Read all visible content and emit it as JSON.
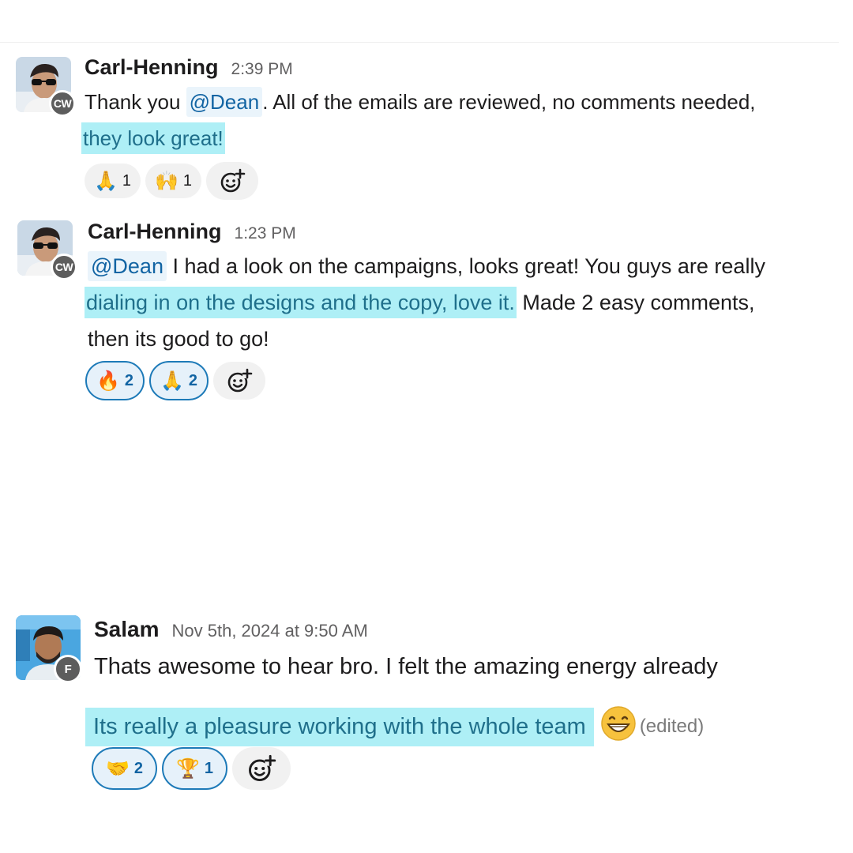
{
  "messages": [
    {
      "author": "Carl-Henning",
      "time": "2:39 PM",
      "badge": "CW",
      "line1_before": "Thank you ",
      "mention": "@Dean",
      "line1_after": ". All of the emails are reviewed, no comments needed,",
      "line2_highlight": "they look great!",
      "reactions": [
        {
          "emoji": "folded-hands-emoji",
          "glyph": "🙏",
          "count": "1",
          "active": false
        },
        {
          "emoji": "raised-hands-emoji",
          "glyph": "🙌",
          "count": "1",
          "active": false
        }
      ]
    },
    {
      "author": "Carl-Henning",
      "time": "1:23 PM",
      "badge": "CW",
      "mention": "@Dean",
      "line1_after": " I had a look on the campaigns, looks great! You guys are really",
      "line2_highlight": "dialing in on the designs and the copy, love it.",
      "line2_after": " Made 2 easy comments,",
      "line3": "then its good to go!",
      "reactions": [
        {
          "emoji": "fire-emoji",
          "glyph": "🔥",
          "count": "2",
          "active": true
        },
        {
          "emoji": "folded-hands-emoji",
          "glyph": "🙏",
          "count": "2",
          "active": true
        }
      ]
    },
    {
      "author": "Salam",
      "time": "Nov 5th, 2024 at 9:50 AM",
      "badge": "F",
      "line1": "Thats awesome to hear bro. I felt the amazing energy already",
      "line2_highlight": "Its really a pleasure working with the whole team",
      "edited": "(edited)",
      "reactions": [
        {
          "emoji": "handshake-emoji",
          "glyph": "🤝",
          "count": "2",
          "active": true
        },
        {
          "emoji": "trophy-emoji",
          "glyph": "🏆",
          "count": "1",
          "active": true
        }
      ]
    }
  ],
  "colors": {
    "mention_bg": "#eaf4fb",
    "mention_text": "#1264a3",
    "highlight_bg": "#aeeff6",
    "reaction_active_border": "#1d7ab8"
  }
}
